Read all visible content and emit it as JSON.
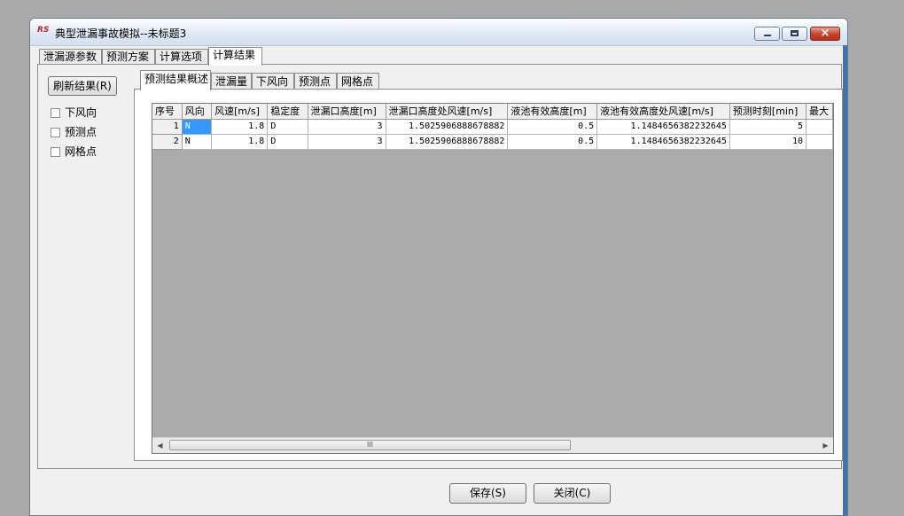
{
  "window": {
    "logo_text": "RS",
    "title": "典型泄漏事故模拟--未标题3",
    "controls": {
      "minimize": "minimize",
      "maximize": "maximize",
      "close": "×"
    }
  },
  "outer_tabs": [
    "泄漏源参数",
    "预测方案",
    "计算选项",
    "计算结果"
  ],
  "outer_tab_active": "计算结果",
  "sidebar": {
    "refresh_button": "刷新结果(R)",
    "checkboxes": [
      {
        "label": "下风向",
        "checked": false
      },
      {
        "label": "预测点",
        "checked": false
      },
      {
        "label": "网格点",
        "checked": false
      }
    ]
  },
  "inner_tabs": [
    "预测结果概述",
    "泄漏量",
    "下风向",
    "预测点",
    "网格点"
  ],
  "inner_tab_active": "预测结果概述",
  "table": {
    "columns": [
      "序号",
      "风向",
      "风速[m/s]",
      "稳定度",
      "泄漏口高度[m]",
      "泄漏口高度处风速[m/s]",
      "液池有效高度[m]",
      "液池有效高度处风速[m/s]",
      "预测时刻[min]",
      "最大"
    ],
    "rows": [
      [
        "1",
        "N",
        "1.8",
        "D",
        "3",
        "1.5025906888678882",
        "0.5",
        "1.1484656382232645",
        "5",
        ""
      ],
      [
        "2",
        "N",
        "1.8",
        "D",
        "3",
        "1.5025906888678882",
        "0.5",
        "1.1484656382232645",
        "10",
        ""
      ]
    ],
    "selected_cell": {
      "row": 0,
      "col": 1
    }
  },
  "scrollbar": {
    "left_arrow": "◀",
    "right_arrow": "▶",
    "grip": "III"
  },
  "footer": {
    "save_button": "保存(S)",
    "close_button": "关闭(C)"
  }
}
